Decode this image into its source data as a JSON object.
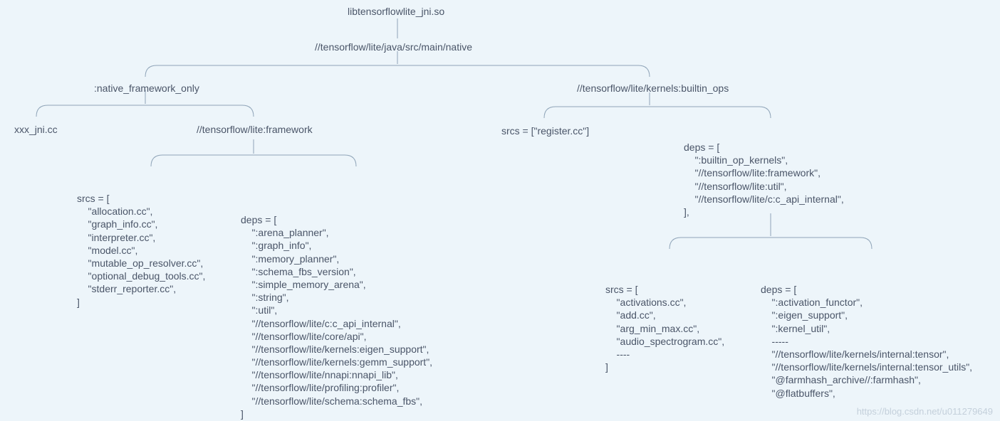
{
  "root": "libtensorflowlite_jni.so",
  "level1": "//tensorflow/lite/java/src/main/native",
  "left": {
    "label": ":native_framework_only",
    "child1": "xxx_jni.cc",
    "child2": "//tensorflow/lite:framework",
    "srcs": "srcs = [\n    \"allocation.cc\",\n    \"graph_info.cc\",\n    \"interpreter.cc\",\n    \"model.cc\",\n    \"mutable_op_resolver.cc\",\n    \"optional_debug_tools.cc\",\n    \"stderr_reporter.cc\",\n]",
    "deps": "deps = [\n    \":arena_planner\",\n    \":graph_info\",\n    \":memory_planner\",\n    \":schema_fbs_version\",\n    \":simple_memory_arena\",\n    \":string\",\n    \":util\",\n    \"//tensorflow/lite/c:c_api_internal\",\n    \"//tensorflow/lite/core/api\",\n    \"//tensorflow/lite/kernels:eigen_support\",\n    \"//tensorflow/lite/kernels:gemm_support\",\n    \"//tensorflow/lite/nnapi:nnapi_lib\",\n    \"//tensorflow/lite/profiling:profiler\",\n    \"//tensorflow/lite/schema:schema_fbs\",\n]"
  },
  "right": {
    "label": "//tensorflow/lite/kernels:builtin_ops",
    "srcs1": "srcs = [\"register.cc\"]",
    "deps1": "deps = [\n    \":builtin_op_kernels\",\n    \"//tensorflow/lite:framework\",\n    \"//tensorflow/lite:util\",\n    \"//tensorflow/lite/c:c_api_internal\",\n],",
    "srcs2": "srcs = [\n    \"activations.cc\",\n    \"add.cc\",\n    \"arg_min_max.cc\",\n    \"audio_spectrogram.cc\",\n    ----\n]",
    "deps2": "deps = [\n    \":activation_functor\",\n    \":eigen_support\",\n    \":kernel_util\",\n    -----\n    \"//tensorflow/lite/kernels/internal:tensor\",\n    \"//tensorflow/lite/kernels/internal:tensor_utils\",\n    \"@farmhash_archive//:farmhash\",\n    \"@flatbuffers\","
  },
  "watermark": "https://blog.csdn.net/u011279649"
}
